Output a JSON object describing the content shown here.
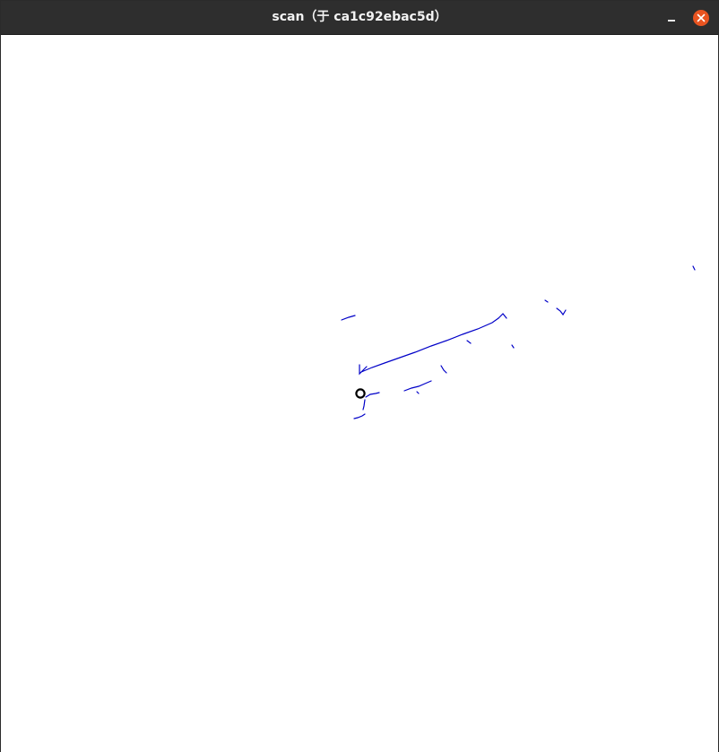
{
  "window": {
    "title": "scan（于 ca1c92ebac5d）",
    "minimize_icon": "minimize-icon",
    "close_icon": "close-icon"
  },
  "colors": {
    "titlebar": "#2e2e2e",
    "close_button": "#e95420",
    "scan_points": "#0000c8",
    "robot_marker": "#000000",
    "canvas_background": "#ffffff"
  },
  "scan": {
    "robot_marker_icon": "robot-position-marker"
  }
}
